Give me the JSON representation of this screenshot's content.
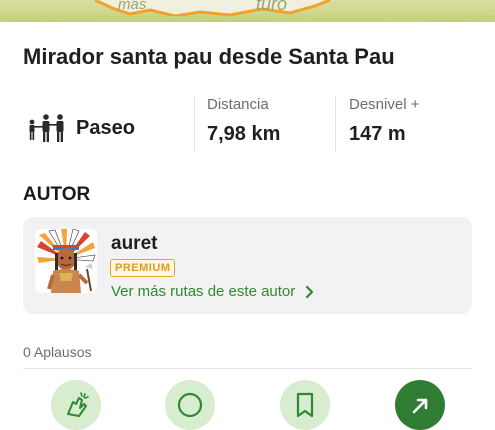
{
  "map_labels": {
    "left": "mas",
    "right": "turo"
  },
  "route": {
    "title": "Mirador santa pau desde Santa Pau",
    "activity_type": "Paseo",
    "activity_icon": "family-walking-icon",
    "stats": [
      {
        "label": "Distancia",
        "value": "7,98 km"
      },
      {
        "label": "Desnivel +",
        "value": "147 m"
      }
    ]
  },
  "author_section": {
    "heading": "AUTOR",
    "name": "auret",
    "badge": "PREMIUM",
    "more_routes_link": "Ver más rutas de este autor"
  },
  "applause": {
    "text": "0 Aplausos"
  },
  "actions": [
    {
      "icon": "clap-icon"
    },
    {
      "icon": "comment-icon"
    },
    {
      "icon": "bookmark-icon"
    },
    {
      "icon": "share-icon"
    }
  ],
  "colors": {
    "accent_green": "#2f8a31",
    "premium_orange": "#e49a1c",
    "card_background": "#f2f2f2",
    "action_background": "#d8eccf",
    "primary_action": "#2f7d32"
  }
}
